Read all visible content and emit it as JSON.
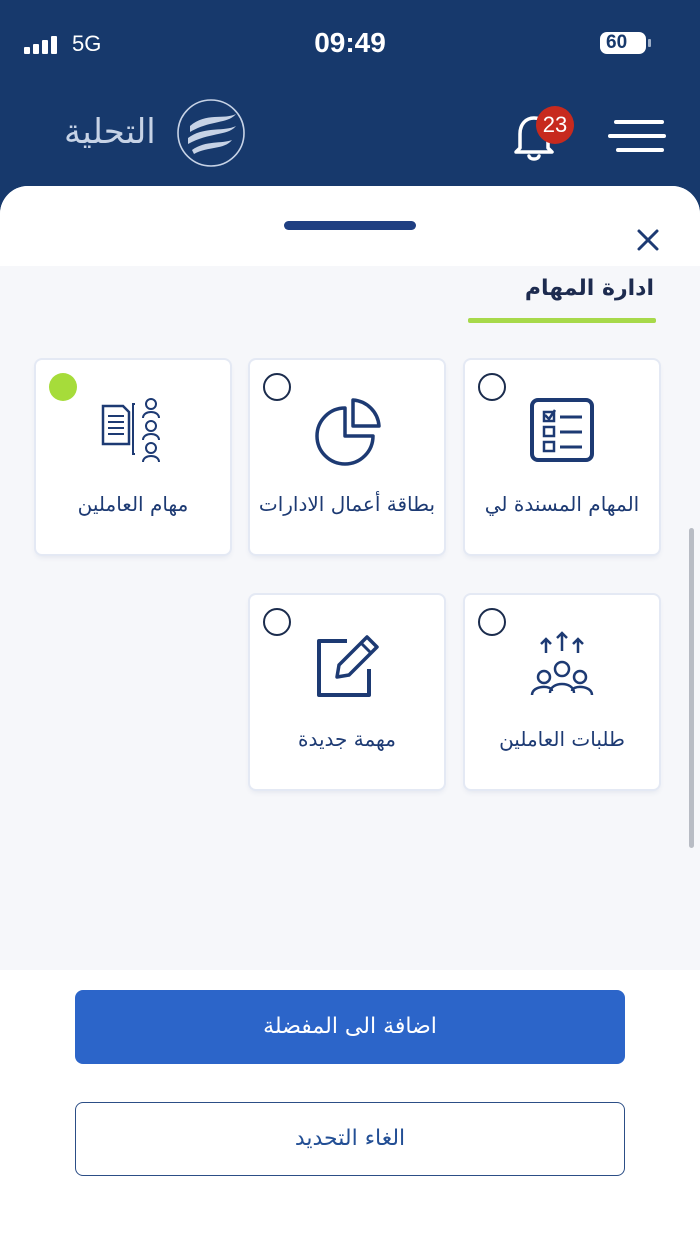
{
  "status_bar": {
    "network": "5G",
    "time": "09:49",
    "battery": "60"
  },
  "header": {
    "app_name": "التحلية",
    "notifications_count": "23"
  },
  "sheet": {
    "tab_title": "ادارة المهام",
    "cards": [
      {
        "label": "المهام المسندة لي",
        "icon": "checklist-icon",
        "selected": false
      },
      {
        "label": "بطاقة أعمال الادارات",
        "icon": "pie-chart-icon",
        "selected": false
      },
      {
        "label": "مهام العاملين",
        "icon": "employees-tasks-icon",
        "selected": true
      },
      {
        "label": "طلبات العاملين",
        "icon": "people-requests-icon",
        "selected": false
      },
      {
        "label": "مهمة جديدة",
        "icon": "edit-icon",
        "selected": false
      }
    ],
    "add_favorite_label": "اضافة الى المفضلة",
    "cancel_selection_label": "الغاء التحديد"
  },
  "colors": {
    "header_bg": "#17396c",
    "accent": "#a6dc3a",
    "primary_button": "#2c65c9",
    "badge": "#c72a1e"
  }
}
